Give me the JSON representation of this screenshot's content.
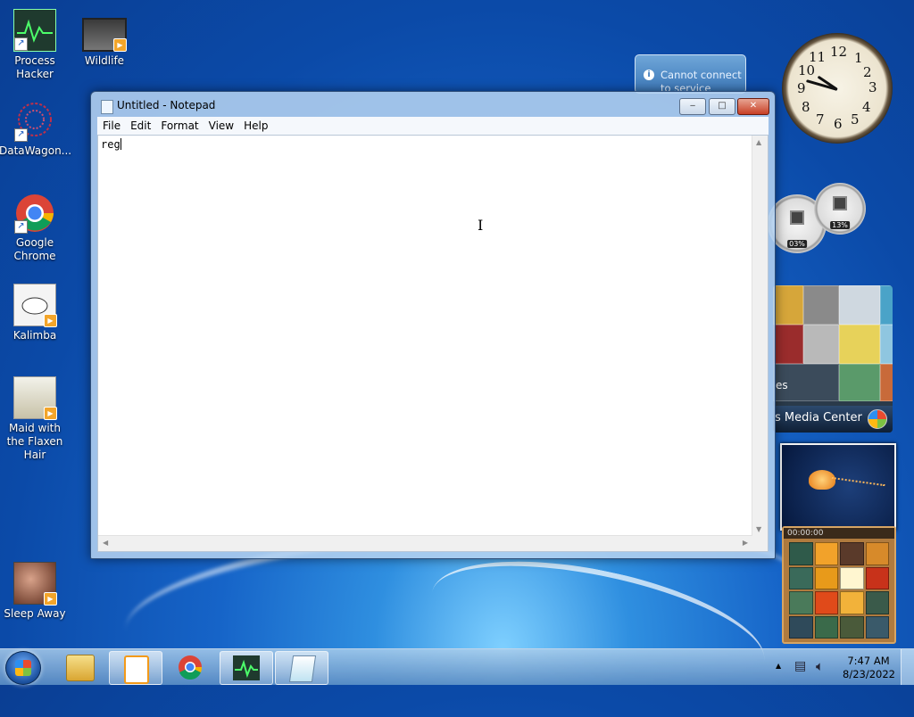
{
  "desktop": {
    "icons": [
      {
        "label": "Process Hacker",
        "icon": "process-hacker-icon"
      },
      {
        "label": "Wildlife",
        "icon": "video-icon"
      },
      {
        "label": "DataWagon...",
        "icon": "datawagon-icon"
      },
      {
        "label": "Google Chrome",
        "icon": "chrome-icon"
      },
      {
        "label": "Kalimba",
        "icon": "audio-icon"
      },
      {
        "label": "Maid with the Flaxen Hair",
        "icon": "audio-icon"
      },
      {
        "label": "Sleep Away",
        "icon": "audio-icon"
      }
    ]
  },
  "notepad": {
    "title": "Untitled - Notepad",
    "menu": [
      "File",
      "Edit",
      "Format",
      "View",
      "Help"
    ],
    "content": "reg",
    "controls": {
      "minimize": "‒",
      "maximize": "□",
      "close": "✕"
    }
  },
  "gadgets": {
    "notification": {
      "text_line1": "Cannot connect",
      "text_line2": "to service"
    },
    "clock": {
      "numbers": [
        "12",
        "1",
        "2",
        "3",
        "4",
        "5",
        "6",
        "7",
        "8",
        "9",
        "10",
        "11"
      ],
      "time": "7:47"
    },
    "cpu_meter": {
      "cpu": "03%",
      "memory": "13%"
    },
    "media_center": {
      "label": "s Media Center",
      "partial_text": "es"
    },
    "puzzle": {
      "timer": "00:00:00"
    }
  },
  "taskbar": {
    "pinned": [
      "windows-explorer-icon",
      "media-player-icon",
      "chrome-icon",
      "process-hacker-icon",
      "notepad-icon"
    ],
    "time": "7:47 AM",
    "date": "8/23/2022"
  },
  "colors": {
    "accent": "#1664c8",
    "close_button": "#c73f25"
  }
}
